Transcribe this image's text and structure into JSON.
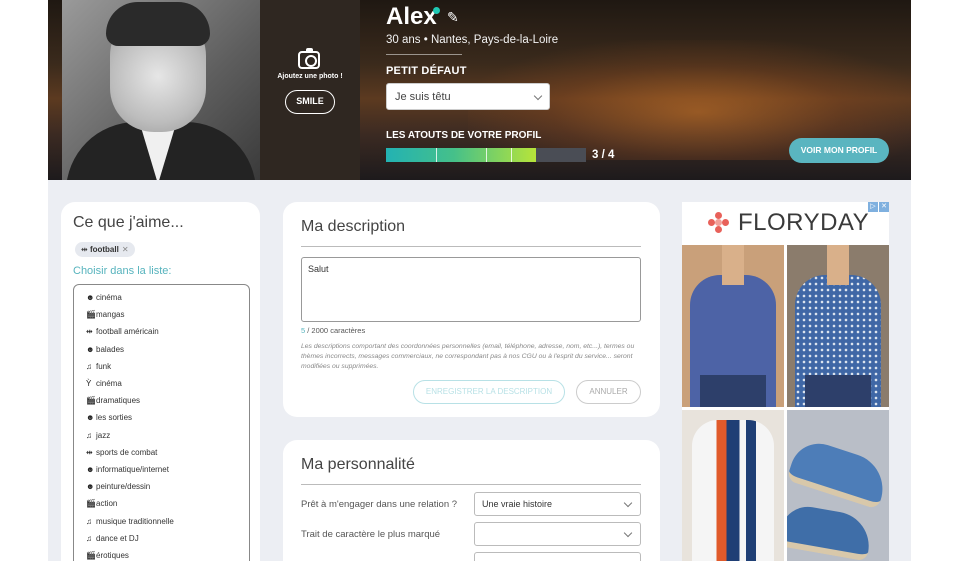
{
  "profile": {
    "name": "Alex",
    "subtitle": "30 ans • Nantes,  Pays-de-la-Loire",
    "add_photo": "Ajoutez une photo !",
    "smile_button": "SMILE",
    "defect_label": "PETIT DÉFAUT",
    "defect_value": "Je suis têtu",
    "atouts_label": "LES ATOUTS DE VOTRE PROFIL",
    "atouts_progress": 0.75,
    "atouts_count": "3 / 4",
    "voir_button": "VOIR MON PROFIL"
  },
  "likes": {
    "title": "Ce que j'aime...",
    "selected_tag": "football",
    "choose_label": "Choisir dans la liste:",
    "items": [
      {
        "icon": "smiley-icon",
        "glyph": "☻",
        "label": "cinéma"
      },
      {
        "icon": "clapper-icon",
        "glyph": "🎬",
        "label": "mangas"
      },
      {
        "icon": "dumbbell-icon",
        "glyph": "⇹",
        "label": "football américain"
      },
      {
        "icon": "smiley-icon",
        "glyph": "☻",
        "label": "balades"
      },
      {
        "icon": "music-note-icon",
        "glyph": "♫",
        "label": "funk"
      },
      {
        "icon": "drink-icon",
        "glyph": "Ỳ",
        "label": "cinéma"
      },
      {
        "icon": "clapper-icon",
        "glyph": "🎬",
        "label": "dramatiques"
      },
      {
        "icon": "smiley-icon",
        "glyph": "☻",
        "label": "les sorties"
      },
      {
        "icon": "music-note-icon",
        "glyph": "♫",
        "label": "jazz"
      },
      {
        "icon": "dumbbell-icon",
        "glyph": "⇹",
        "label": "sports de combat"
      },
      {
        "icon": "smiley-icon",
        "glyph": "☻",
        "label": "informatique/internet"
      },
      {
        "icon": "smiley-icon",
        "glyph": "☻",
        "label": "peinture/dessin"
      },
      {
        "icon": "clapper-icon",
        "glyph": "🎬",
        "label": "action"
      },
      {
        "icon": "music-note-icon",
        "glyph": "♫",
        "label": "musique traditionnelle"
      },
      {
        "icon": "music-note-icon",
        "glyph": "♫",
        "label": "dance et DJ"
      },
      {
        "icon": "clapper-icon",
        "glyph": "🎬",
        "label": "érotiques"
      }
    ]
  },
  "description": {
    "title": "Ma description",
    "text": "Salut",
    "char_count_num": "5",
    "char_count_rest": " / 2000 caractères",
    "note": "Les descriptions comportant des coordonnées personnelles (email, téléphone, adresse, nom, etc...), termes ou thèmes incorrects, messages commerciaux, ne correspondant pas à nos CGU ou à l'esprit du service... seront modifiées ou supprimées.",
    "save_button": "ENREGISTRER LA DESCRIPTION",
    "cancel_button": "ANNULER"
  },
  "personality": {
    "title": "Ma personnalité",
    "q1_label": "Prêt à m'engager dans une relation ?",
    "q1_value": "Une vraie histoire",
    "q2_label": "Trait de caractère le plus marqué",
    "q2_value": "",
    "q3_value": ""
  },
  "ad": {
    "brand": "FLORYDAY"
  },
  "colors": {
    "accent": "#56b3bd",
    "button": "#5ab5c0",
    "online": "#1fc9b4",
    "background": "#eceef3"
  }
}
